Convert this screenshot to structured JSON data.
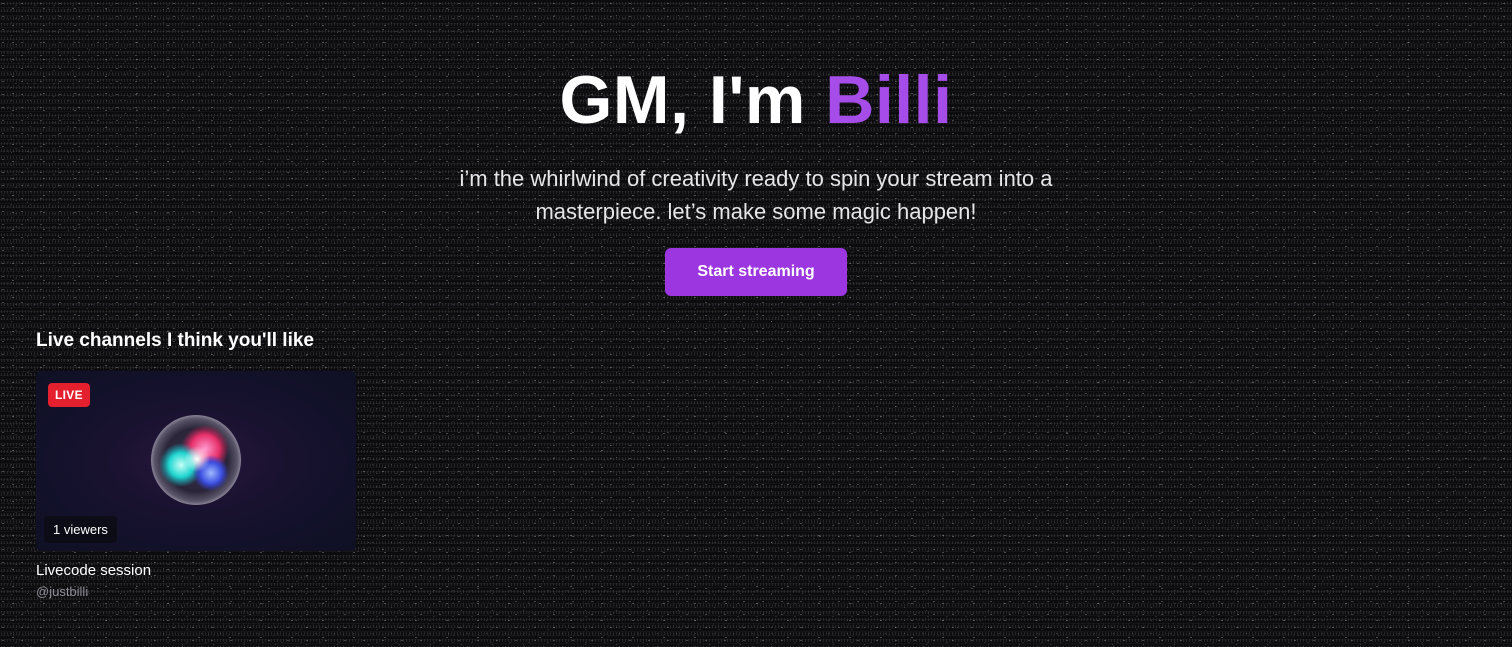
{
  "hero": {
    "title_prefix": "GM, I'm ",
    "title_name": "Billi",
    "subtitle": "i’m the whirlwind of creativity ready to spin your stream into a masterpiece. let’s make some magic happen!",
    "cta_label": "Start streaming"
  },
  "live_section": {
    "title": "Live channels I think you'll like",
    "channels": [
      {
        "badge": "LIVE",
        "viewers": "1 viewers",
        "title": "Livecode session",
        "handle": "@justbilli",
        "thumbnail_icon": "siri-orb-icon"
      }
    ]
  },
  "colors": {
    "accent": "#a64de9",
    "button": "#9b36e0",
    "live_badge": "#e5202e",
    "background": "#0c0c0e"
  }
}
